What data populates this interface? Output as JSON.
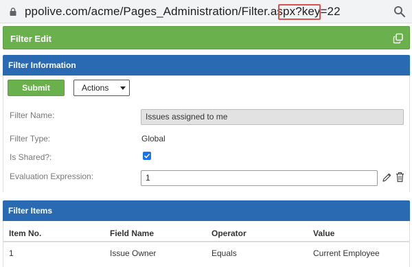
{
  "browser": {
    "url": "ppolive.com/acme/Pages_Administration/Filter.aspx?key=22",
    "highlight_color": "#d9534f"
  },
  "edit_header": {
    "title": "Filter Edit",
    "icon": "copy-icon"
  },
  "filter_information": {
    "title": "Filter Information",
    "submit_label": "Submit",
    "actions_label": "Actions",
    "fields": {
      "name_label": "Filter Name:",
      "name_value": "Issues assigned to me",
      "type_label": "Filter Type:",
      "type_value": "Global",
      "shared_label": "Is Shared?:",
      "shared_checked": true,
      "expression_label": "Evaluation Expression:",
      "expression_value": "1"
    }
  },
  "filter_items": {
    "title": "Filter Items",
    "columns": [
      "Item No.",
      "Field Name",
      "Operator",
      "Value"
    ],
    "rows": [
      [
        "1",
        "Issue Owner",
        "Equals",
        "Current Employee"
      ]
    ]
  },
  "colors": {
    "green": "#6ab04c",
    "blue": "#2a6ab3"
  }
}
